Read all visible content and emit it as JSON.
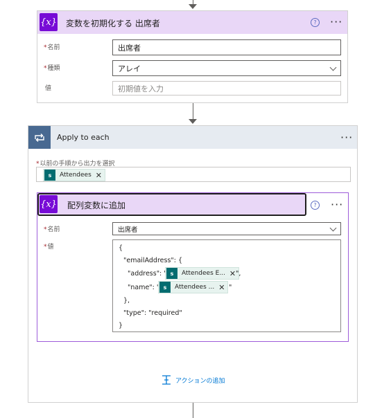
{
  "card1": {
    "title": "変数を初期化する 出席者",
    "icon_text": "{x}",
    "fields": [
      {
        "label": "名前",
        "required": true,
        "value": "出席者"
      },
      {
        "label": "種類",
        "required": true,
        "value": "アレイ"
      },
      {
        "label": "値",
        "required": false,
        "placeholder": "初期値を入力"
      }
    ]
  },
  "loop": {
    "title": "Apply to each",
    "select_label": "以前の手順から出力を選択",
    "token": "Attendees"
  },
  "inner": {
    "title": "配列変数に追加",
    "icon_text": "{x}",
    "name_label": "名前",
    "name_value": "出席者",
    "value_label": "値",
    "json": {
      "l1": "{",
      "l2": "\"emailAddress\": {",
      "l3_pre": "\"address\": \"",
      "l3_token": "Attendees E...",
      "l3_post": "\",",
      "l4_pre": "\"name\": \"",
      "l4_token": "Attendees ...",
      "l4_post": "\"",
      "l5": "},",
      "l6": "\"type\": \"required\"",
      "l7": "}"
    }
  },
  "add_action": "アクションの追加",
  "colors": {
    "variable": "#770bd6",
    "loop": "#486991",
    "sharepoint": "#036c70",
    "link": "#0078d4"
  }
}
